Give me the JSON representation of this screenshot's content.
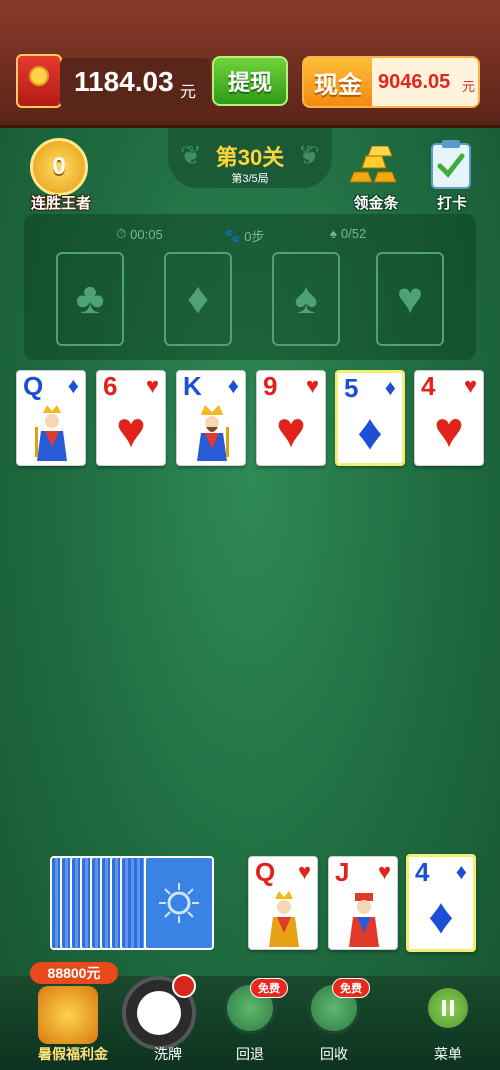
{
  "top": {
    "balance": "1184.03",
    "balance_unit": "元",
    "withdraw_label": "提现",
    "cash_label": "现金",
    "cash_value": "9046.05",
    "cash_unit": "元"
  },
  "header": {
    "streak_count": "0",
    "streak_label": "连胜王者",
    "level_title": "第30关",
    "level_sub": "第3/5局",
    "gold_label": "领金条",
    "checkin_label": "打卡"
  },
  "stats": {
    "time": "00:05",
    "steps": "0步",
    "progress": "0/52"
  },
  "foundations": [
    {
      "suit_icon": "club-icon",
      "glyph": "♣"
    },
    {
      "suit_icon": "diamond-icon",
      "glyph": "♦"
    },
    {
      "suit_icon": "spade-icon",
      "glyph": "♠"
    },
    {
      "suit_icon": "heart-icon",
      "glyph": "♥"
    }
  ],
  "tableau": [
    {
      "rank": "Q",
      "suit": "♦",
      "color": "blue",
      "face": true
    },
    {
      "rank": "6",
      "suit": "♥",
      "color": "red",
      "face": false
    },
    {
      "rank": "K",
      "suit": "♦",
      "color": "blue",
      "face": true
    },
    {
      "rank": "9",
      "suit": "♥",
      "color": "red",
      "face": false
    },
    {
      "rank": "5",
      "suit": "♦",
      "color": "blue",
      "face": false,
      "selected": true
    },
    {
      "rank": "4",
      "suit": "♥",
      "color": "red",
      "face": false
    }
  ],
  "waste": [
    {
      "rank": "Q",
      "suit": "♥",
      "color": "red",
      "face": true
    },
    {
      "rank": "J",
      "suit": "♥",
      "color": "red",
      "face": true
    },
    {
      "rank": "4",
      "suit": "♦",
      "color": "blue",
      "face": false
    }
  ],
  "bottom": {
    "bonus_amount": "88800元",
    "bonus_label": "暑假福利金",
    "shuffle_label": "洗牌",
    "undo_label": "回退",
    "recycle_label": "回收",
    "menu_label": "菜单",
    "free_badge": "免费"
  },
  "colors": {
    "felt": "#1f6b40",
    "red_suit": "#e0231b",
    "blue_suit": "#1c4fd6",
    "accent_gold": "#ffd43a"
  }
}
